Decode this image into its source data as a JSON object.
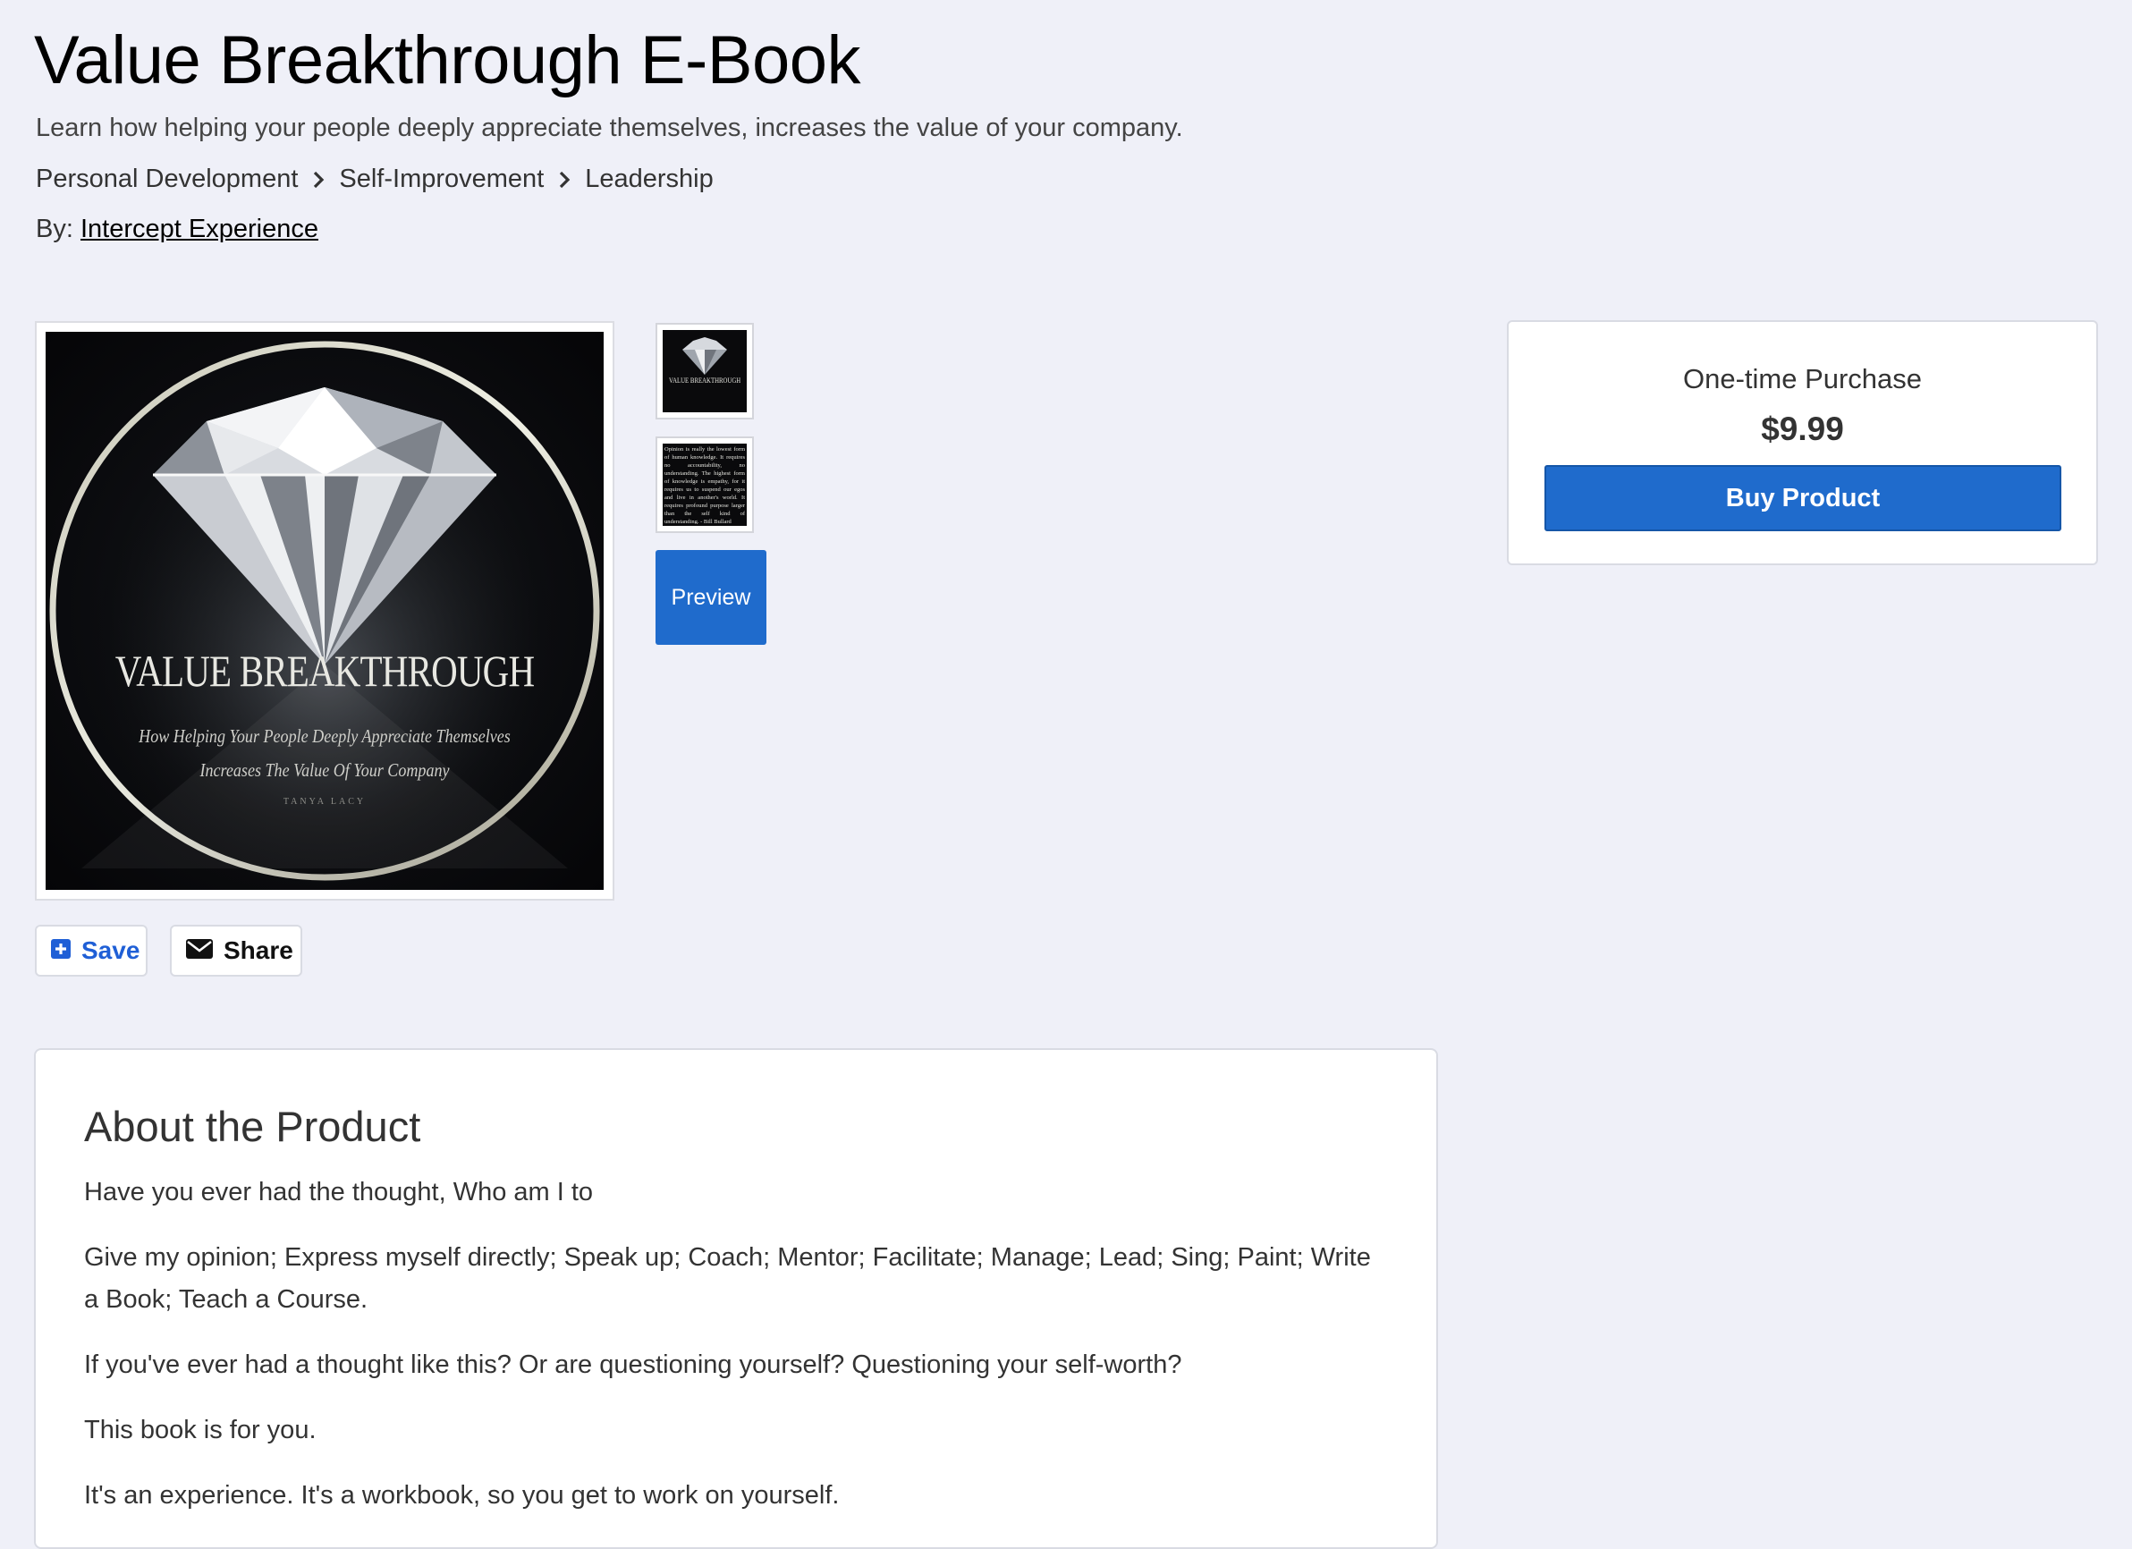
{
  "product": {
    "title": "Value Breakthrough E-Book",
    "subtitle": "Learn how helping your people deeply appreciate themselves, increases the value of your company.",
    "breadcrumb": [
      "Personal Development",
      "Self-Improvement",
      "Leadership"
    ],
    "by_label": "By:",
    "author": "Intercept Experience"
  },
  "cover": {
    "title": "VALUE BREAKTHROUGH",
    "subtitle_line1": "How Helping Your People Deeply Appreciate Themselves",
    "subtitle_line2": "Increases The Value Of Your Company",
    "author": "TANYA LACY"
  },
  "thumbnails": {
    "thumb1_title": "VALUE BREAKTHROUGH",
    "thumb2_text": "Opinion is really the lowest form of human knowledge. It requires no accountability, no understanding. The highest form of knowledge is empathy, for it requires us to suspend our egos and live in another's world. It requires profound purpose larger than the self kind of understanding. - Bill Bullard"
  },
  "buttons": {
    "preview": "Preview",
    "save": "Save",
    "share": "Share",
    "buy": "Buy Product"
  },
  "purchase": {
    "label": "One-time Purchase",
    "price": "$9.99"
  },
  "about": {
    "heading": "About the Product",
    "paragraphs": [
      "Have you ever had the thought, Who am I to",
      "Give my opinion; Express myself directly; Speak up; Coach; Mentor; Facilitate; Manage; Lead; Sing; Paint; Write a Book; Teach a Course.",
      "If you've ever had a thought like this? Or are questioning yourself? Questioning your self-worth?",
      "This book is for you.",
      "It's an experience. It's a workbook, so you get to work on yourself."
    ]
  },
  "colors": {
    "background": "#eff0f8",
    "primary_button": "#1f6bcc",
    "save_accent": "#1f5fd6"
  }
}
